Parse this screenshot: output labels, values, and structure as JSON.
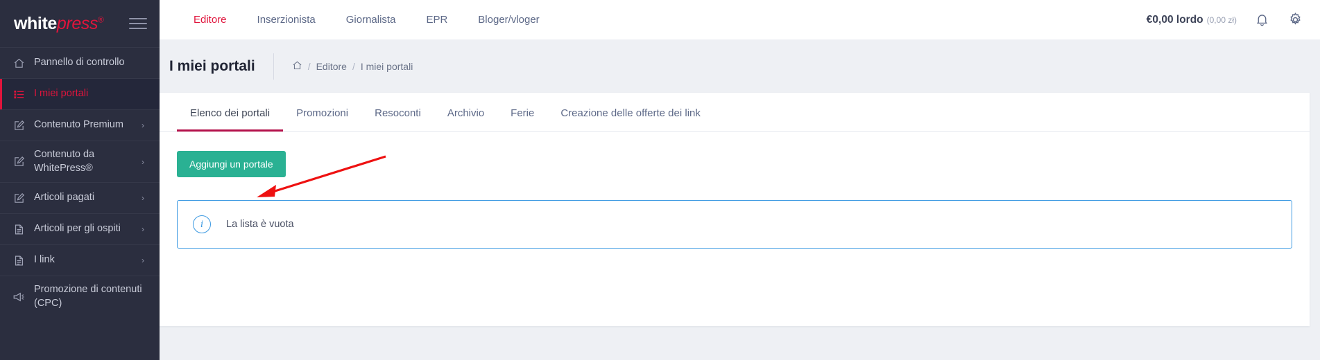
{
  "brand": {
    "name_part1": "white",
    "name_part2": "press",
    "registered": "®",
    "menu_icon": "hamburger-icon"
  },
  "sidebar": {
    "items": [
      {
        "label": "Pannello di controllo",
        "icon": "home-icon",
        "active": false,
        "chevron": false
      },
      {
        "label": "I miei portali",
        "icon": "list-icon",
        "active": true,
        "chevron": false
      },
      {
        "label": "Contenuto Premium",
        "icon": "edit-document-icon",
        "active": false,
        "chevron": true
      },
      {
        "label": "Contenuto da WhitePress®",
        "icon": "edit-document-icon",
        "active": false,
        "chevron": true
      },
      {
        "label": "Articoli pagati",
        "icon": "edit-document-icon",
        "active": false,
        "chevron": true
      },
      {
        "label": "Articoli per gli ospiti",
        "icon": "document-icon",
        "active": false,
        "chevron": true
      },
      {
        "label": "I link",
        "icon": "document-icon",
        "active": false,
        "chevron": true
      },
      {
        "label": "Promozione di contenuti (CPC)",
        "icon": "megaphone-icon",
        "active": false,
        "chevron": false
      }
    ]
  },
  "topbar": {
    "nav": [
      {
        "label": "Editore",
        "active": true
      },
      {
        "label": "Inserzionista",
        "active": false
      },
      {
        "label": "Giornalista",
        "active": false
      },
      {
        "label": "EPR",
        "active": false
      },
      {
        "label": "Bloger/vloger",
        "active": false
      }
    ],
    "balance": "€0,00 lordo",
    "balance_secondary": "(0,00 zł)",
    "notifications_icon": "bell-icon",
    "settings_icon": "gear-icon"
  },
  "page": {
    "title": "I miei portali",
    "breadcrumb": {
      "home_icon": "home-icon",
      "items": [
        {
          "label": "Editore",
          "current": false
        },
        {
          "label": "I miei portali",
          "current": true
        }
      ],
      "separator": "/"
    }
  },
  "content": {
    "tabs": [
      {
        "label": "Elenco dei portali",
        "active": true
      },
      {
        "label": "Promozioni",
        "active": false
      },
      {
        "label": "Resoconti",
        "active": false
      },
      {
        "label": "Archivio",
        "active": false
      },
      {
        "label": "Ferie",
        "active": false
      },
      {
        "label": "Creazione delle offerte dei link",
        "active": false
      }
    ],
    "add_button_label": "Aggiungi un portale",
    "empty_notice": {
      "icon": "info-icon",
      "text": "La lista è vuota"
    }
  },
  "annotation": {
    "type": "red-arrow",
    "color": "#ee1111",
    "points_to": "add-portal-button"
  },
  "colors": {
    "brand_red": "#e0143c",
    "sidebar_bg": "#2b2e3f",
    "sidebar_active_bg": "#24273a",
    "accent_teal": "#2ab193",
    "tab_underline": "#b3104a",
    "info_blue": "#3d9ae2",
    "page_bg": "#eef0f4"
  }
}
